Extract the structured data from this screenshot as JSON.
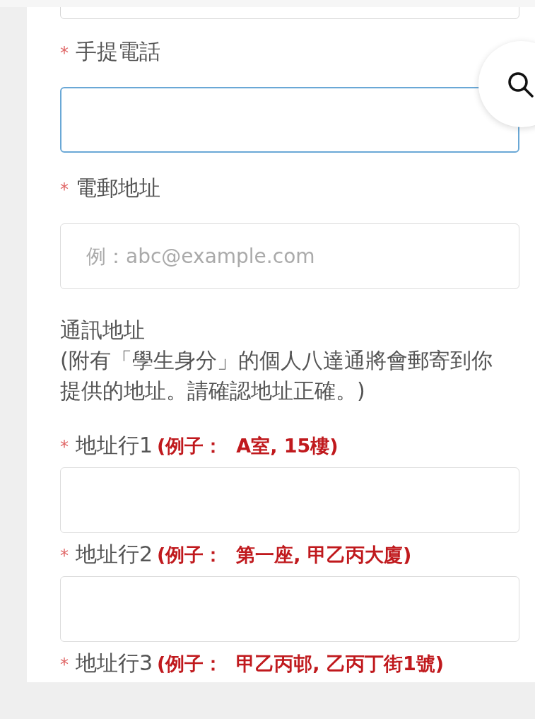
{
  "contact_fields": [
    {
      "marker": "*",
      "label": "手提電話",
      "focused": true
    },
    {
      "marker": "*",
      "label": "電郵地址",
      "focused": false,
      "placeholder": "例：abc@example.com"
    }
  ],
  "address_section": {
    "title": "通訊地址",
    "note": "(附有「學生身分」的個人八達通將會郵寄到你提供的地址。請確認地址正確。)"
  },
  "address_fields": [
    {
      "kind": "field",
      "marker": "*",
      "label": "地址行1",
      "hint": "(例子：  A室, 15樓)"
    },
    {
      "kind": "field",
      "marker": "*",
      "label": "地址行2",
      "hint": "(例子：  第一座, 甲乙丙大廈)"
    },
    {
      "kind": "label",
      "marker": "*",
      "label": "地址行3",
      "hint": "(例子：  甲乙丙邨, 乙丙丁街1號)"
    }
  ]
}
